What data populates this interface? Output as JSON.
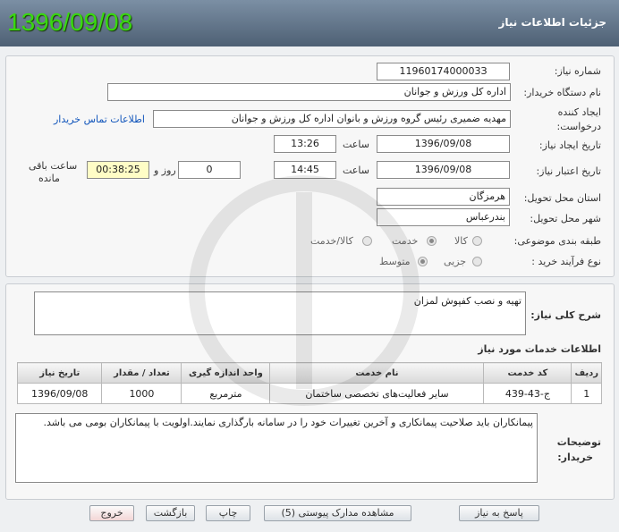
{
  "header": {
    "title": "جزئیات اطلاعات نیاز",
    "date": "1396/09/08"
  },
  "form": {
    "need_number_label": "شماره نیاز:",
    "need_number": "1196017400003З",
    "buyer_label": "نام دستگاه خریدار:",
    "buyer": "اداره کل ورزش و جوانان",
    "creator_label_1": "ایجاد کننده",
    "creator_label_2": "درخواست:",
    "creator": "مهدیه ضمیری رئیس گروه ورزش و بانوان اداره کل ورزش و جوانان",
    "contact_link": "اطلاعات تماس خریدار",
    "announce_label": "تاریخ ایجاد نیاز:",
    "announce_date": "1396/09/08",
    "time_label": "ساعت",
    "announce_time": "13:26",
    "valid_label": "تاریخ اعتبار نیاز:",
    "valid_date": "1396/09/08",
    "valid_time": "14:45",
    "days_value": "0",
    "days_label": "روز و",
    "remaining_time": "00:38:25",
    "remaining_label_1": "ساعت باقی",
    "remaining_label_2": "مانده",
    "province_label": "استان محل تحویل:",
    "province": "هرمزگان",
    "city_label": "شهر محل تحویل:",
    "city": "بندرعباس",
    "category_label": "طبقه بندی موضوعی:",
    "category_options": [
      "کالا",
      "خدمت",
      "کالا/خدمت"
    ],
    "process_label": "نوع فرآیند خرید :",
    "process_options": [
      "جزیی",
      "متوسط"
    ]
  },
  "description": {
    "label": "شرح کلی نیاز:",
    "text": "تهیه و نصب کفپوش لمزان"
  },
  "services": {
    "title": "اطلاعات خدمات مورد نیاز",
    "headers": [
      "ردیف",
      "کد خدمت",
      "نام خدمت",
      "واحد اندازه گیری",
      "تعداد / مقدار",
      "تاریخ نیاز"
    ],
    "rows": [
      [
        "1",
        "ج-43-439",
        "سایر فعالیت‌های تخصصی ساختمان",
        "مترمربع",
        "1000",
        "1396/09/08"
      ]
    ]
  },
  "notes": {
    "label_1": "توضیحات",
    "label_2": "خریدار:",
    "text": "پیمانکاران باید صلاحیت پیمانکاری و آخرین تغییرات خود را در سامانه بارگذاری نمایند.اولویت با پیمانکاران بومی می باشد."
  },
  "buttons": {
    "reply": "پاسخ به نیاز",
    "attachments": "مشاهده مدارک پیوستی (5)",
    "print": "چاپ",
    "back": "بازگشت",
    "exit": "خروج"
  },
  "colors": {
    "header_bg": "#5b6d81",
    "date_green": "#39d90f",
    "link_blue": "#1155bb"
  }
}
